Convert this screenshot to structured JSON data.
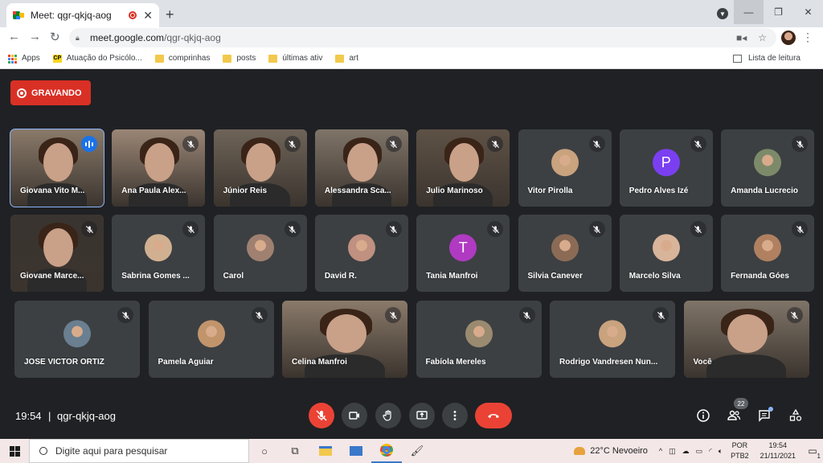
{
  "browser": {
    "tab_title": "Meet: qgr-qkjq-aog",
    "url_host": "meet.google.com",
    "url_path": "/qgr-qkjq-aog",
    "bookmarks": [
      {
        "label": "Apps",
        "icon": "apps-grid-icon"
      },
      {
        "label": "Atuação do Psicólo...",
        "icon": "cp-icon"
      },
      {
        "label": "comprinhas",
        "icon": "folder-icon"
      },
      {
        "label": "posts",
        "icon": "folder-icon"
      },
      {
        "label": "últimas ativ",
        "icon": "folder-icon"
      },
      {
        "label": "art",
        "icon": "folder-icon"
      }
    ],
    "reading_list": "Lista de leitura"
  },
  "meet": {
    "recording_label": "GRAVANDO",
    "participants": [
      {
        "name": "Giovana Vito M...",
        "kind": "video",
        "speaking": true
      },
      {
        "name": "Ana Paula Alex...",
        "kind": "video"
      },
      {
        "name": "Júnior Reis",
        "kind": "video"
      },
      {
        "name": "Alessandra Sca...",
        "kind": "video"
      },
      {
        "name": "Julio Marinoso",
        "kind": "video"
      },
      {
        "name": "Vitor Pirolla",
        "kind": "photo"
      },
      {
        "name": "Pedro Alves Izé",
        "kind": "letter",
        "letter": "P",
        "color": "#7b3ff2"
      },
      {
        "name": "Amanda Lucrecio",
        "kind": "photo"
      },
      {
        "name": "Giovane Marce...",
        "kind": "video"
      },
      {
        "name": "Sabrina Gomes ...",
        "kind": "photo"
      },
      {
        "name": "Carol",
        "kind": "photo"
      },
      {
        "name": "David R.",
        "kind": "photo"
      },
      {
        "name": "Tania Manfroi",
        "kind": "letter",
        "letter": "T",
        "color": "#b03ac2"
      },
      {
        "name": "Silvia Canever",
        "kind": "photo"
      },
      {
        "name": "Marcelo Silva",
        "kind": "photo"
      },
      {
        "name": "Fernanda Góes",
        "kind": "photo"
      },
      {
        "name": "JOSE VICTOR ORTIZ",
        "kind": "photo"
      },
      {
        "name": "Pamela Aguiar",
        "kind": "photo"
      },
      {
        "name": "Celina Manfroi",
        "kind": "video"
      },
      {
        "name": "Fabíola Mereles",
        "kind": "photo"
      },
      {
        "name": "Rodrigo Vandresen Nun...",
        "kind": "photo"
      },
      {
        "name": "Você",
        "kind": "video"
      }
    ],
    "time": "19:54",
    "separator": "|",
    "meeting_code": "qgr-qkjq-aog",
    "people_count": "22"
  },
  "taskbar": {
    "search_placeholder": "Digite aqui para pesquisar",
    "weather": "22°C  Nevoeiro",
    "lang_top": "POR",
    "lang_bottom": "PTB2",
    "clock_time": "19:54",
    "clock_date": "21/11/2021",
    "notif_count": "1"
  }
}
